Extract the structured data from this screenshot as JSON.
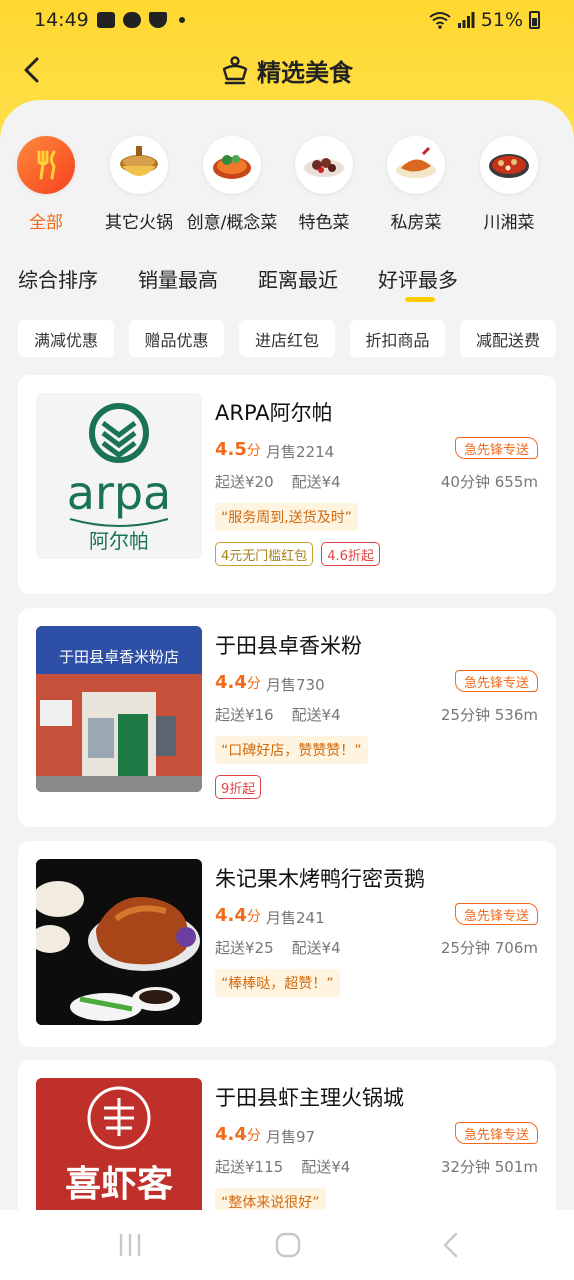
{
  "status_bar": {
    "time": "14:49",
    "battery": "51%"
  },
  "header": {
    "title": "精选美食"
  },
  "categories": [
    {
      "label": "全部",
      "icon": "fork-knife-icon",
      "active": true
    },
    {
      "label": "其它火锅",
      "icon": "hotpot-icon"
    },
    {
      "label": "创意/概念菜",
      "icon": "creative-dish-icon"
    },
    {
      "label": "特色菜",
      "icon": "specialty-dish-icon"
    },
    {
      "label": "私房菜",
      "icon": "private-dish-icon"
    },
    {
      "label": "川湘菜",
      "icon": "sichuan-dish-icon"
    }
  ],
  "sort_tabs": [
    "综合排序",
    "销量最高",
    "距离最近",
    "好评最多"
  ],
  "active_sort": "好评最多",
  "filters": [
    "满减优惠",
    "赠品优惠",
    "进店红包",
    "折扣商品",
    "减配送费"
  ],
  "stores": [
    {
      "name": "ARPA阿尔帕",
      "rating": "4.5",
      "rating_unit": "分",
      "sales": "月售2214",
      "badge": "急先锋专送",
      "min_order": "起送¥20",
      "delivery_fee": "配送¥4",
      "distance": "40分钟 655m",
      "quote": "“服务周到,送货及时”",
      "tags": [
        {
          "text": "4元无门槛红包",
          "style": "gold"
        },
        {
          "text": "4.6折起",
          "style": "red"
        }
      ],
      "logo": {
        "brand": "arpa",
        "brand_cn": "阿尔帕"
      }
    },
    {
      "name": "于田县卓香米粉",
      "rating": "4.4",
      "rating_unit": "分",
      "sales": "月售730",
      "badge": "急先锋专送",
      "min_order": "起送¥16",
      "delivery_fee": "配送¥4",
      "distance": "25分钟 536m",
      "quote": "“口碑好店，赞赞赞！”",
      "tags": [
        {
          "text": "9折起",
          "style": "red"
        }
      ],
      "logo": {
        "sign": "于田县卓香米粉店"
      }
    },
    {
      "name": "朱记果木烤鸭行密贡鹅",
      "rating": "4.4",
      "rating_unit": "分",
      "sales": "月售241",
      "badge": "急先锋专送",
      "min_order": "起送¥25",
      "delivery_fee": "配送¥4",
      "distance": "25分钟 706m",
      "quote": "“棒棒哒，超赞！”",
      "tags": []
    },
    {
      "name": "于田县虾主理火锅城",
      "rating": "4.4",
      "rating_unit": "分",
      "sales": "月售97",
      "badge": "急先锋专送",
      "min_order": "起送¥115",
      "delivery_fee": "配送¥4",
      "distance": "32分钟 501m",
      "quote": "“整体来说很好”",
      "tags": [],
      "logo": {
        "brand_cn": "喜虾客"
      }
    }
  ],
  "colors": {
    "brand_yellow": "#ffd830",
    "accent_orange": "#f26a1b",
    "tag_red": "#e04444"
  }
}
